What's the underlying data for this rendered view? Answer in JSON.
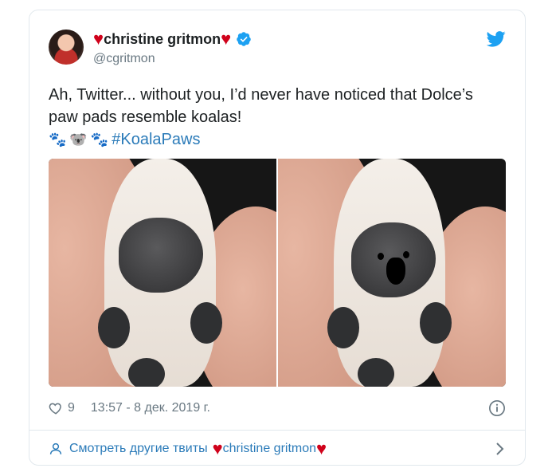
{
  "tweet": {
    "display_name": "christine gritmon",
    "heart_glyph": "♥",
    "handle": "@cgritmon",
    "text_line1": "Ah, Twitter... without you, I’d never have noticed that Dolce’s",
    "text_line2": "paw pads resemble koalas!",
    "emojis": [
      "🐾",
      "🐨",
      "🐾"
    ],
    "hashtag": "#KoalaPaws",
    "likes": "9",
    "timestamp": "13:57 - 8 дек. 2019 г."
  },
  "footer": {
    "label": "Смотреть другие твиты",
    "name": "christine gritmon"
  },
  "colors": {
    "link": "#2b7bb9",
    "heart": "#d0021b",
    "verified": "#1da1f2",
    "muted": "#697882"
  },
  "icons": [
    "twitter-bird-icon",
    "verified-icon",
    "heart-outline-icon",
    "info-icon",
    "user-icon",
    "chevron-right-icon"
  ]
}
